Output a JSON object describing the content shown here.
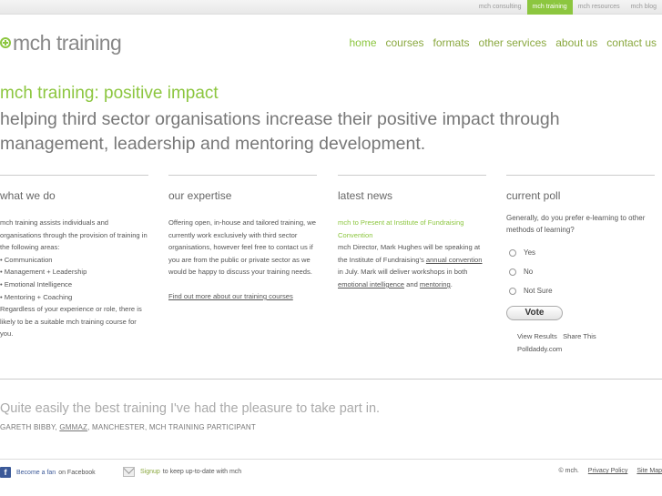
{
  "topbar": {
    "links": [
      "mch consulting",
      "mch training",
      "mch resources",
      "mch blog"
    ],
    "active": "mch training"
  },
  "logo": {
    "text": "mch training"
  },
  "nav": {
    "items": [
      "home",
      "courses",
      "formats",
      "other services",
      "about us",
      "contact us"
    ],
    "active": "home"
  },
  "hero": {
    "title": "mch training: positive impact",
    "subtitle": "helping third sector organisations increase their positive impact through management, leadership and mentoring development."
  },
  "what_we_do": {
    "heading": "what we do",
    "intro": "mch training assists individuals and organisations through the provision of training in the following areas:",
    "items": [
      "• Communication",
      "• Management + Leadership",
      "• Emotional Intelligence",
      "• Mentoring + Coaching"
    ],
    "outro": "Regardless of your experience or role, there is likely to be a suitable mch training course for you."
  },
  "expertise": {
    "heading": "our expertise",
    "body": "Offering open, in-house and tailored training, we currently work exclusively with third sector organisations, however feel free to contact us if you are from the public or private sector as we would be happy to discuss your training needs.",
    "link": "Find out more about our training courses"
  },
  "news": {
    "heading": "latest news",
    "title": "mch to Present at Institute of Fundraising Convention",
    "body_1": "mch Director, Mark Hughes will be speaking at the Institute of Fundraising's ",
    "link_1": "annual convention",
    "body_2": " in July.  Mark will deliver workshops in both ",
    "link_2": "emotional intelligence",
    "body_3": " and ",
    "link_3": "mentoring",
    "body_4": "."
  },
  "poll": {
    "heading": "current poll",
    "question": "Generally, do you prefer e-learning to other methods of learning?",
    "options": [
      "Yes",
      "No",
      "Not Sure"
    ],
    "vote_label": "Vote",
    "view_results": "View Results",
    "share": "Share This",
    "credit": "Polldaddy.com"
  },
  "testimonial": {
    "quote": "Quite easily the best training I've had the pleasure to take part in.",
    "author_pre": "GARETH BIBBY, ",
    "author_link": "GMMAZ",
    "author_post": ", MANCHESTER, MCH TRAINING PARTICIPANT"
  },
  "footer": {
    "fb_link": "Become a fan",
    "fb_text": "on Facebook",
    "signup_link": "Signup",
    "signup_text": "to keep up-to-date with mch",
    "copyright": "© mch.",
    "privacy": "Privacy Policy",
    "sitemap": "Site Map"
  }
}
